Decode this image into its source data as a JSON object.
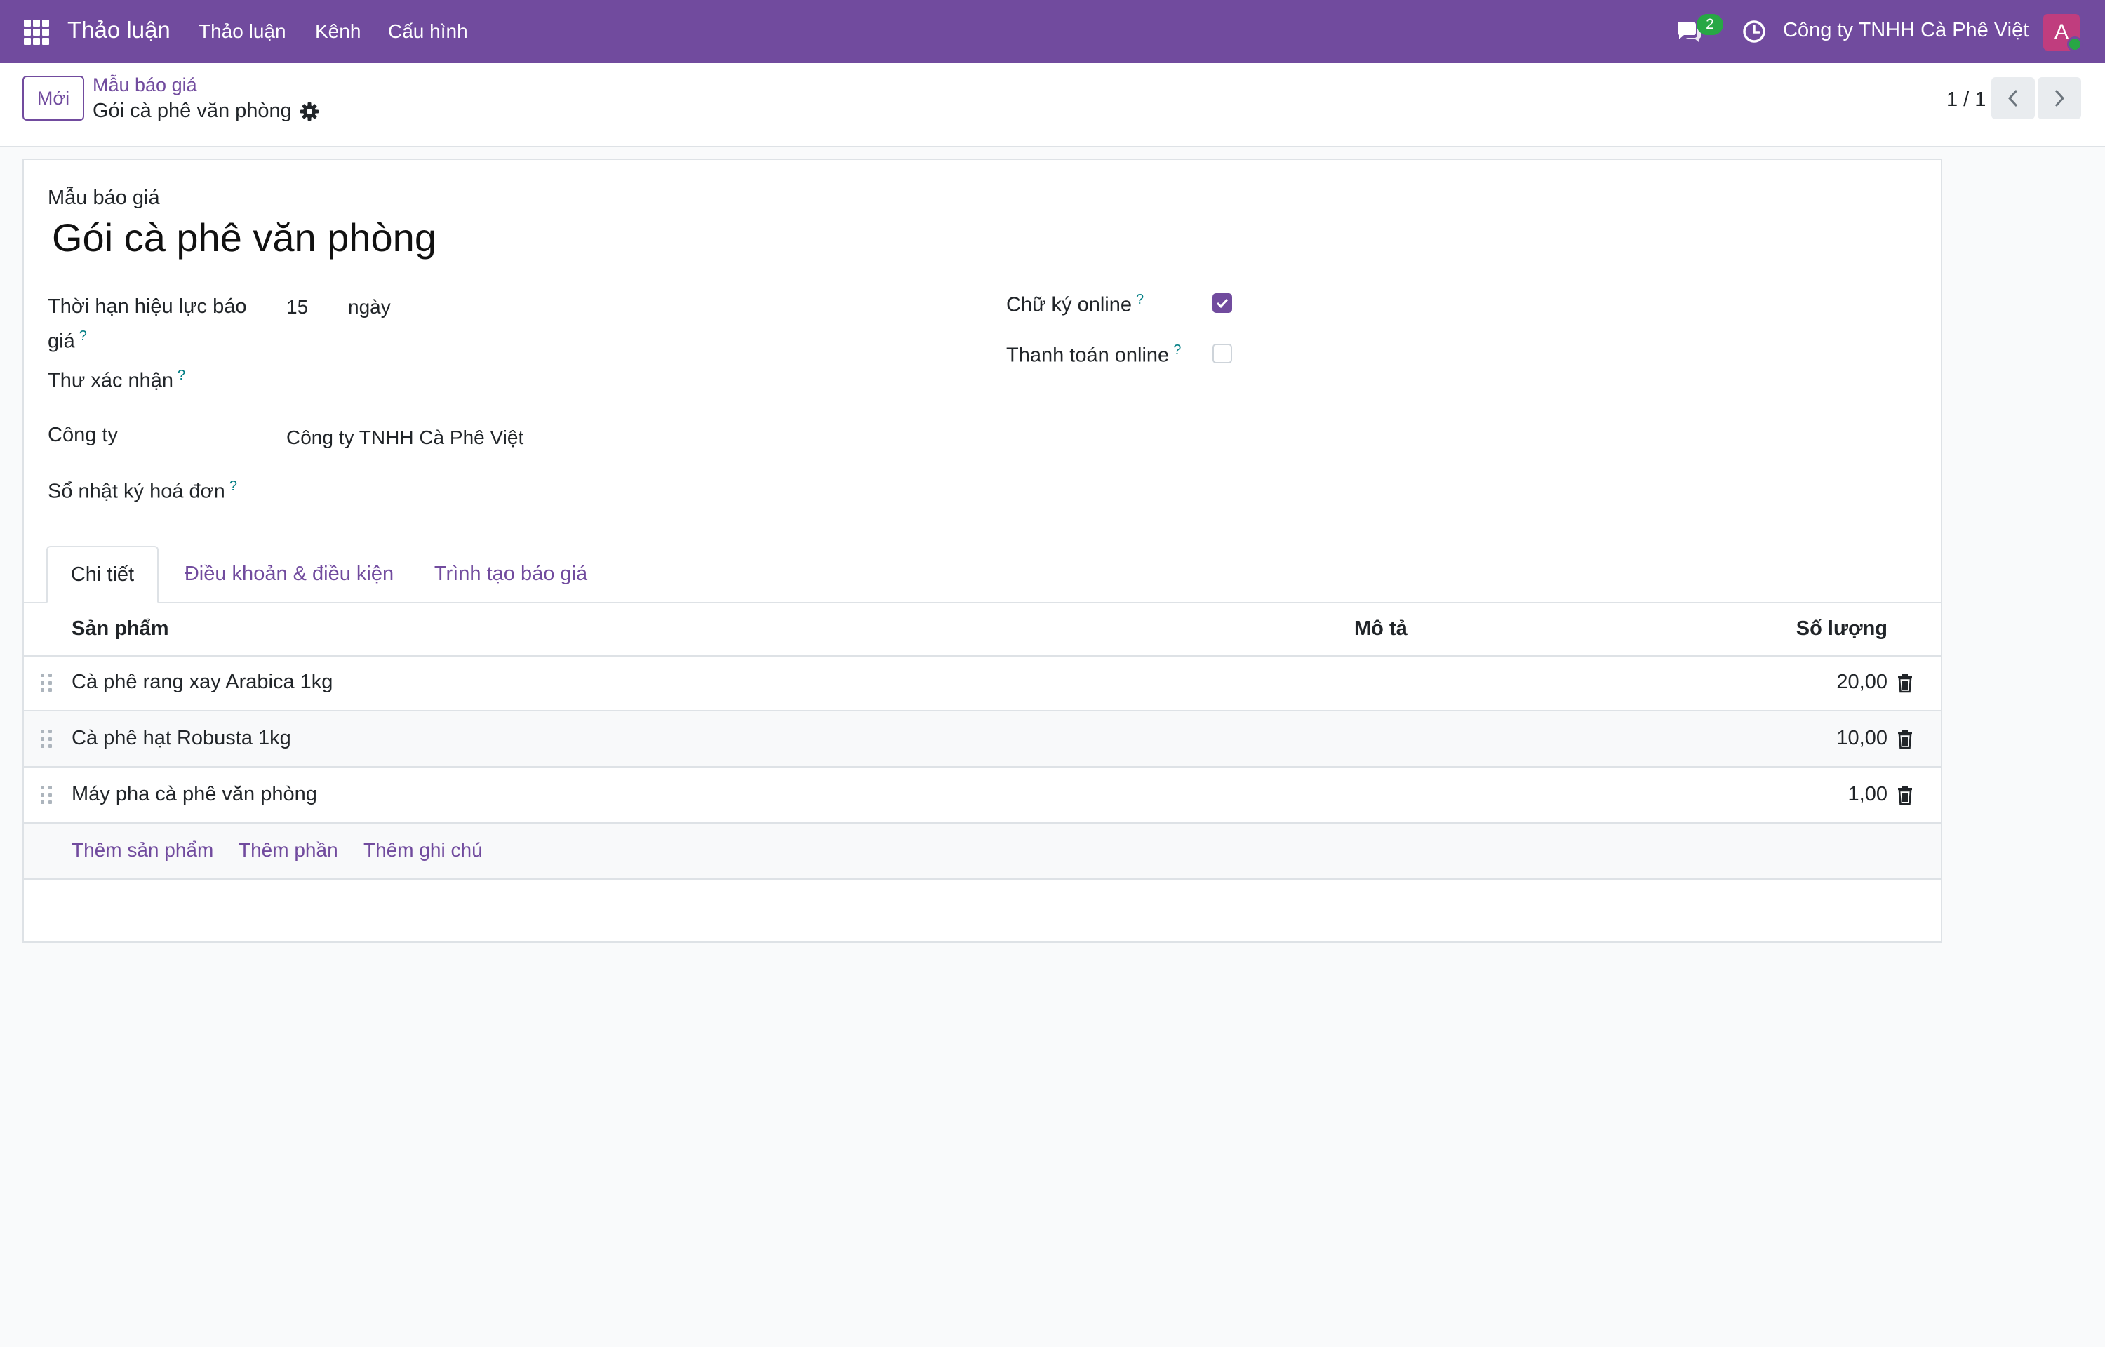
{
  "navbar": {
    "app_name": "Thảo luận",
    "menu": [
      "Thảo luận",
      "Kênh",
      "Cấu hình"
    ],
    "message_count": "2",
    "company": "Công ty TNHH Cà Phê Việt",
    "avatar_letter": "A",
    "colors": {
      "bar": "#714b9e",
      "badge": "#28a745",
      "avatar": "#c03d7e"
    }
  },
  "control_panel": {
    "new_button": "Mới",
    "breadcrumb_parent": "Mẫu báo giá",
    "breadcrumb_current": "Gói cà phê văn phòng",
    "pager": "1 / 1"
  },
  "form": {
    "section_label": "Mẫu báo giá",
    "name": "Gói cà phê văn phòng",
    "validity_label_1": "Thời hạn hiệu lực báo",
    "validity_label_2": "giá",
    "validity_value": "15",
    "validity_unit": "ngày",
    "confirmation_mail_label": "Thư xác nhận",
    "company_label": "Công ty",
    "company_value": "Công ty TNHH Cà Phê Việt",
    "journal_label": "Sổ nhật ký hoá đơn",
    "online_signature_label": "Chữ ký online",
    "online_signature_checked": true,
    "online_payment_label": "Thanh toán online",
    "online_payment_checked": false,
    "help_mark": "?"
  },
  "tabs": [
    "Chi tiết",
    "Điều khoản & điều kiện",
    "Trình tạo báo giá"
  ],
  "table": {
    "headers": {
      "product": "Sản phẩm",
      "description": "Mô tả",
      "quantity": "Số lượng"
    },
    "rows": [
      {
        "product": "Cà phê rang xay Arabica 1kg",
        "quantity": "20,00"
      },
      {
        "product": "Cà phê hạt Robusta 1kg",
        "quantity": "10,00"
      },
      {
        "product": "Máy pha cà phê văn phòng",
        "quantity": "1,00"
      }
    ],
    "add_links": [
      "Thêm sản phẩm",
      "Thêm phần",
      "Thêm ghi chú"
    ]
  }
}
